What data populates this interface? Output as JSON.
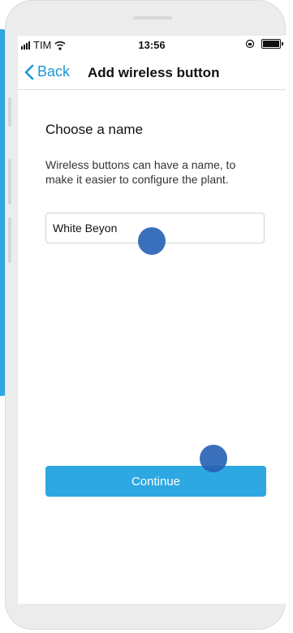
{
  "status_bar": {
    "carrier": "TIM",
    "time": "13:56"
  },
  "navbar": {
    "back_label": "Back",
    "title": "Add wireless button"
  },
  "content": {
    "heading": "Choose a name",
    "description": "Wireless buttons can have a name, to make it easier to configure the plant.",
    "name_input": {
      "value": "White Beyon",
      "placeholder": ""
    },
    "continue_label": "Continue"
  },
  "colors": {
    "accent": "#2ea8e2",
    "link": "#1c95d6",
    "touch_indicator": "#255fb4"
  },
  "icons": {
    "signal": "signal-icon",
    "wifi": "wifi-icon",
    "rotation_lock": "rotation-lock-icon",
    "battery": "battery-icon",
    "back": "chevron-left-icon"
  }
}
